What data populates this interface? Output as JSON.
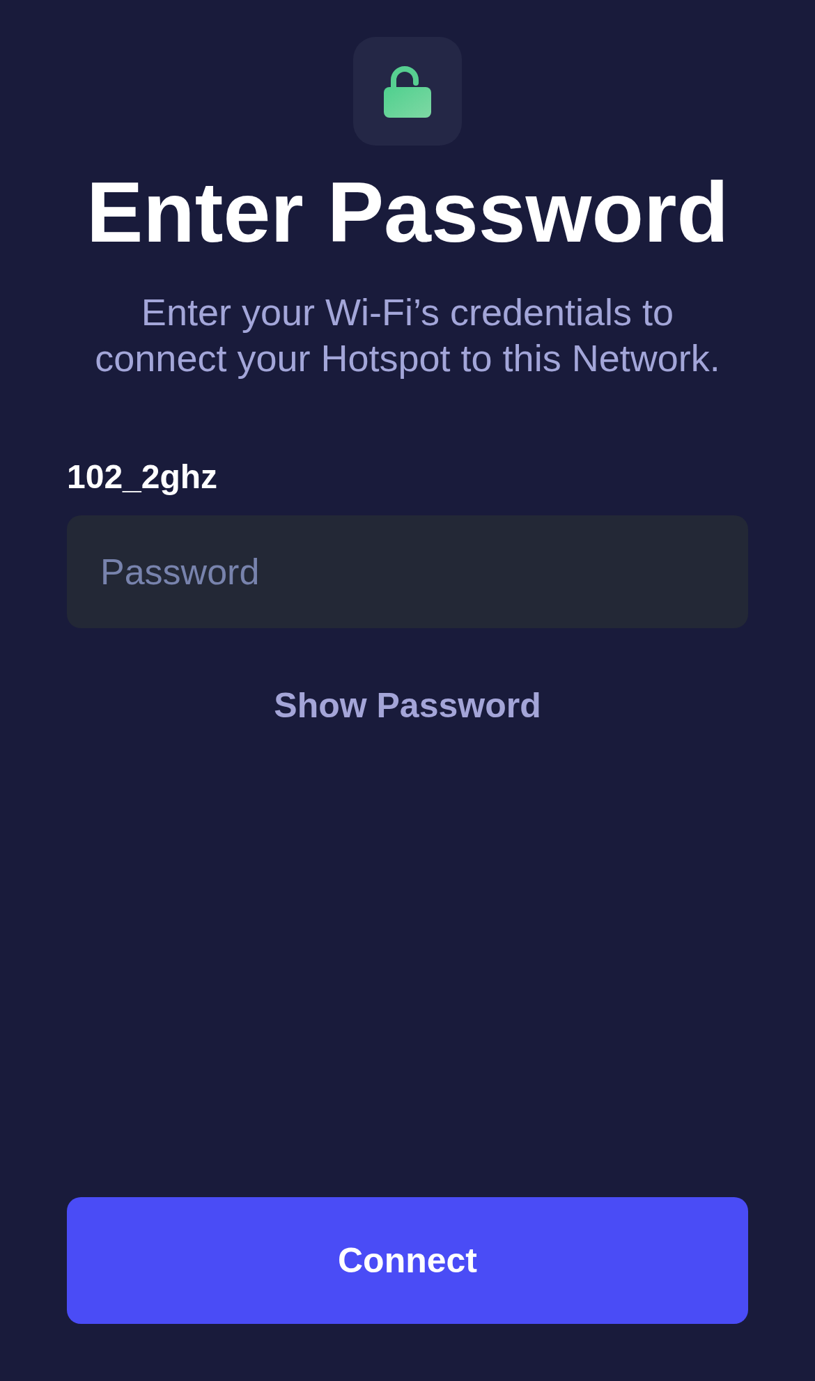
{
  "title": "Enter Password",
  "subtitle": "Enter your Wi-Fi’s credentials to connect your Hotspot to this Network.",
  "network_name": "102_2ghz",
  "password_field": {
    "placeholder": "Password"
  },
  "show_password": {
    "label": "Show Password"
  },
  "connect_button": {
    "label": "Connect"
  }
}
